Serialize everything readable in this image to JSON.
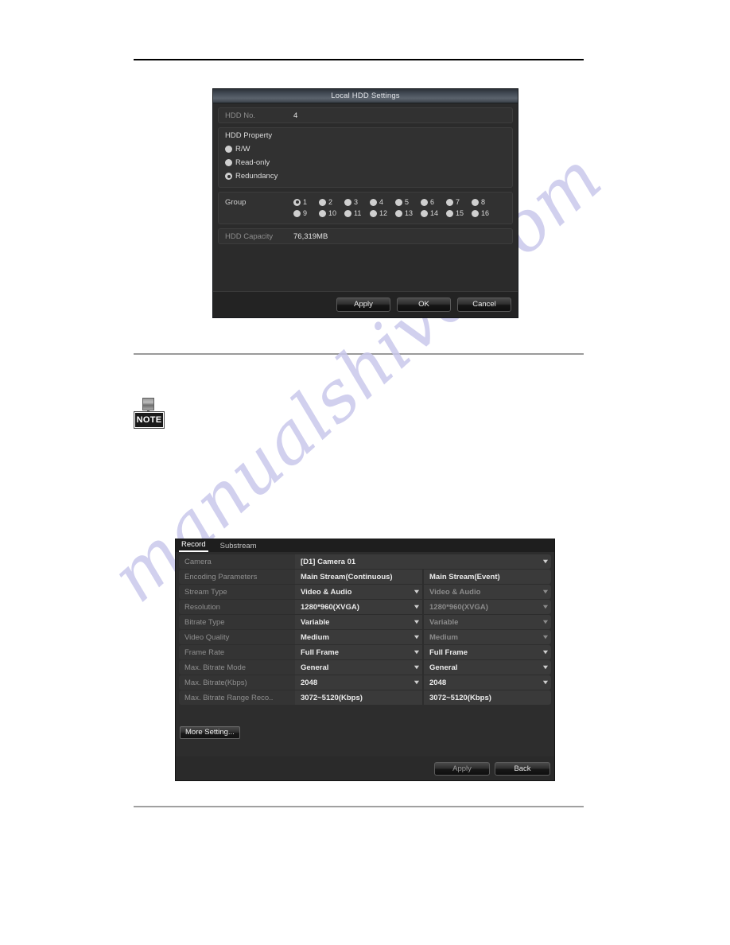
{
  "page": {
    "watermark": "manualshive.com",
    "note_icon_label": "NOTE"
  },
  "hdd_dialog": {
    "title": "Local HDD Settings",
    "hdd_no_label": "HDD No.",
    "hdd_no_value": "4",
    "property_title": "HDD Property",
    "property_options": [
      {
        "label": "R/W",
        "selected": false
      },
      {
        "label": "Read-only",
        "selected": false
      },
      {
        "label": "Redundancy",
        "selected": true
      }
    ],
    "group_label": "Group",
    "group_options": [
      {
        "label": "1",
        "selected": true
      },
      {
        "label": "2",
        "selected": false
      },
      {
        "label": "3",
        "selected": false
      },
      {
        "label": "4",
        "selected": false
      },
      {
        "label": "5",
        "selected": false
      },
      {
        "label": "6",
        "selected": false
      },
      {
        "label": "7",
        "selected": false
      },
      {
        "label": "8",
        "selected": false
      },
      {
        "label": "9",
        "selected": false
      },
      {
        "label": "10",
        "selected": false
      },
      {
        "label": "11",
        "selected": false
      },
      {
        "label": "12",
        "selected": false
      },
      {
        "label": "13",
        "selected": false
      },
      {
        "label": "14",
        "selected": false
      },
      {
        "label": "15",
        "selected": false
      },
      {
        "label": "16",
        "selected": false
      }
    ],
    "capacity_label": "HDD Capacity",
    "capacity_value": "76,319MB",
    "buttons": {
      "apply": "Apply",
      "ok": "OK",
      "cancel": "Cancel"
    }
  },
  "record_dialog": {
    "tabs": [
      {
        "label": "Record",
        "active": true
      },
      {
        "label": "Substream",
        "active": false
      }
    ],
    "camera_label": "Camera",
    "camera_value": "[D1] Camera 01",
    "encoding_label": "Encoding Parameters",
    "column_continuous": "Main Stream(Continuous)",
    "column_event": "Main Stream(Event)",
    "rows": [
      {
        "label": "Stream Type",
        "continuous": "Video & Audio",
        "event": "Video & Audio",
        "dropdown": true
      },
      {
        "label": "Resolution",
        "continuous": "1280*960(XVGA)",
        "event": "1280*960(XVGA)",
        "dropdown": true
      },
      {
        "label": "Bitrate Type",
        "continuous": "Variable",
        "event": "Variable",
        "dropdown": true
      },
      {
        "label": "Video Quality",
        "continuous": "Medium",
        "event": "Medium",
        "dropdown": true
      },
      {
        "label": "Frame Rate",
        "continuous": "Full Frame",
        "event": "Full Frame",
        "dropdown": true
      },
      {
        "label": "Max. Bitrate Mode",
        "continuous": "General",
        "event": "General",
        "dropdown": true
      },
      {
        "label": "Max. Bitrate(Kbps)",
        "continuous": "2048",
        "event": "2048",
        "dropdown": true
      },
      {
        "label": "Max. Bitrate Range Reco..",
        "continuous": "3072~5120(Kbps)",
        "event": "3072~5120(Kbps)",
        "dropdown": false
      }
    ],
    "more_setting_label": "More Setting...",
    "buttons": {
      "apply": "Apply",
      "back": "Back"
    }
  },
  "colors": {
    "dialog_bg": "#2b2b2b",
    "panel_bg": "#313131",
    "titlebar_accent": "#5b636d",
    "watermark": "#c9c8ec",
    "text_dim": "#8d8d8d",
    "text_lit": "#ececec"
  }
}
